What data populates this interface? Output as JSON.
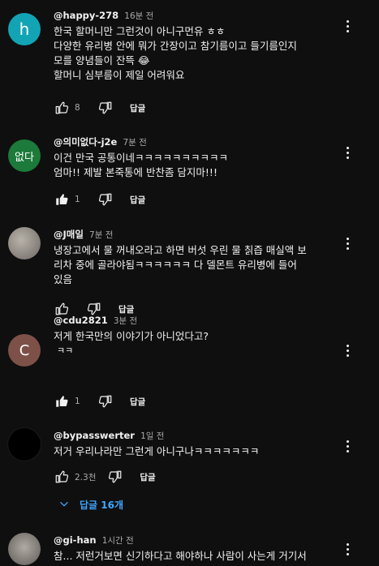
{
  "comments": [
    {
      "author": "@happy-278",
      "time": "16분 전",
      "avatar_text": "h",
      "avatar_color": "#12a4b4",
      "lines": [
        "한국 할머니만 그런것이 아니구먼유 ㅎㅎ",
        "다양한 유리병 안에 뭐가 간장이고 참기름이고 들기름인지",
        "모를 양념들이 잔뜩 😂",
        "할머니 심부름이 제일 어려워요"
      ],
      "likes": "8",
      "reply_label": "답글"
    },
    {
      "author": "@의미없다-j2e",
      "time": "7분 전",
      "avatar_text": "없다",
      "avatar_color": "#1c7a3a",
      "lines": [
        "이건 만국 공통이네ㅋㅋㅋㅋㅋㅋㅋㅋㅋㅋ",
        "엄마!! 제발 본죽통에 반찬좀 담지마!!!"
      ],
      "likes": "1",
      "reply_label": "답글"
    },
    {
      "author": "@J매일",
      "time": "7분 전",
      "avatar_text": "",
      "avatar_color": "#9a9590",
      "lines": [
        "냉장고에서 물 꺼내오라고 하면 버섯 우린 물 칡즙 매실액 보",
        "리차 중에 골라야됨ㅋㅋㅋㅋㅋㅋ 다 델몬트 유리병에 들어",
        "있음"
      ],
      "likes": "",
      "reply_label": "답글"
    },
    {
      "author": "@cdu2821",
      "time": "3분 전",
      "avatar_text": "C",
      "avatar_color": "#7d5148",
      "lines": [
        "저게 한국만의 이야기가 아니었다고?",
        "ㅋㅋ"
      ],
      "likes": "1",
      "reply_label": "답글"
    },
    {
      "author": "@bypasswerter",
      "time": "1일 전",
      "avatar_text": "",
      "avatar_color": "#000000",
      "lines": [
        "저거 우리나라만 그런게 아니구나ㅋㅋㅋㅋㅋㅋㅋ"
      ],
      "likes": "2.3천",
      "reply_label": "답글"
    },
    {
      "author": "@gi-han",
      "time": "1시간 전",
      "avatar_text": "",
      "avatar_color": "#8a8580",
      "lines": [
        "참... 저런거보면 신기하다고 해야하나 사람이 사는게 거기서"
      ],
      "likes": "",
      "reply_label": ""
    }
  ],
  "replies_toggle": {
    "label": "답글 16개"
  },
  "colors": {
    "background": "#0f0f0f",
    "text": "#f1f1f1",
    "muted": "#aaaaaa",
    "link": "#3ea6ff"
  },
  "icons": [
    "thumb-up-icon",
    "thumb-down-icon",
    "more-vert-icon",
    "chevron-down-icon"
  ]
}
